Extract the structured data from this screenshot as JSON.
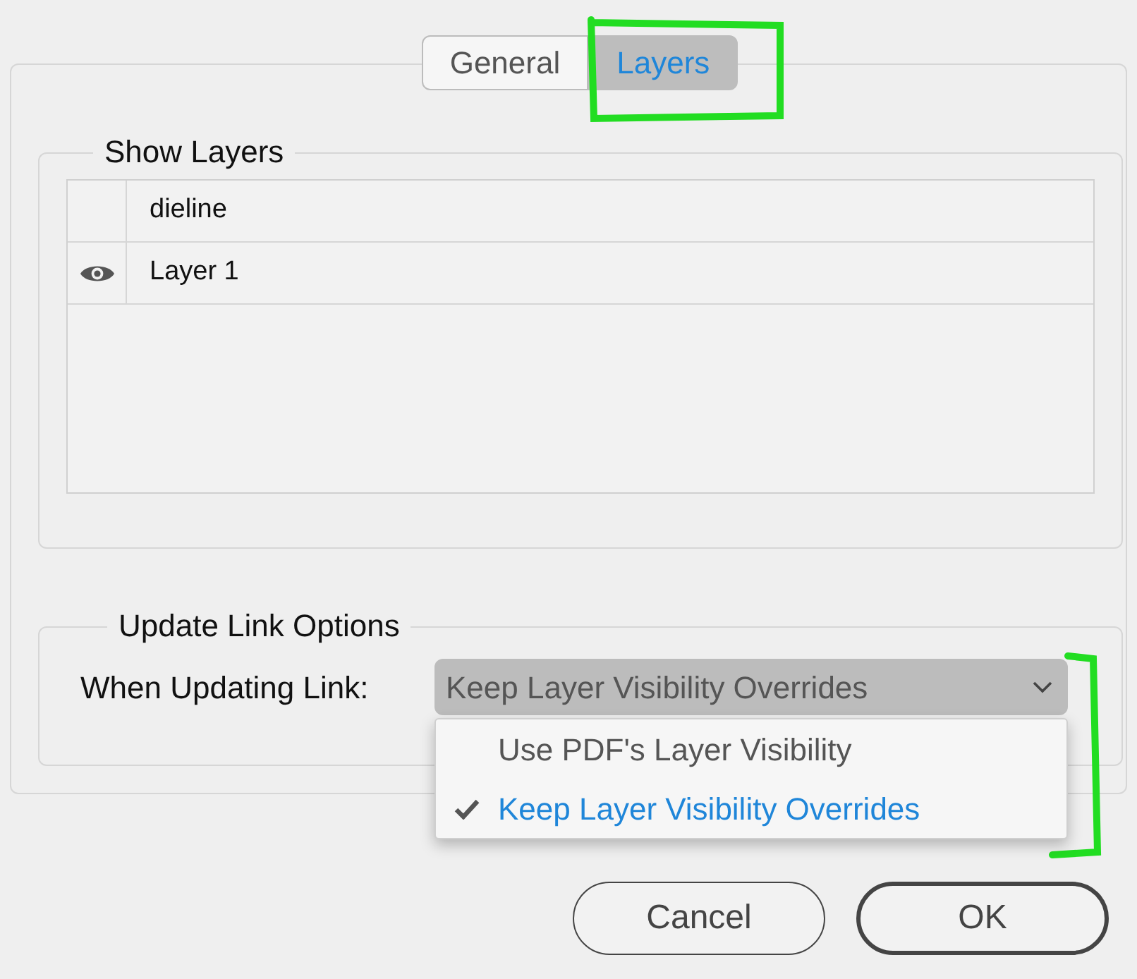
{
  "tabs": [
    {
      "label": "General",
      "selected": false
    },
    {
      "label": "Layers",
      "selected": true
    }
  ],
  "show_layers": {
    "title": "Show Layers",
    "layers": [
      {
        "name": "dieline",
        "visible": false
      },
      {
        "name": "Layer 1",
        "visible": true
      }
    ]
  },
  "update_link_options": {
    "title": "Update Link Options",
    "label": "When Updating Link:",
    "value": "Keep Layer Visibility Overrides",
    "expanded": true,
    "options": [
      {
        "label": "Use PDF's Layer Visibility",
        "selected": false
      },
      {
        "label": "Keep Layer Visibility Overrides",
        "selected": true
      }
    ]
  },
  "buttons": [
    {
      "label": "Cancel",
      "kind": "secondary"
    },
    {
      "label": "OK",
      "kind": "default"
    }
  ],
  "annotations": [
    {
      "kind": "box"
    },
    {
      "kind": "bracket"
    }
  ]
}
